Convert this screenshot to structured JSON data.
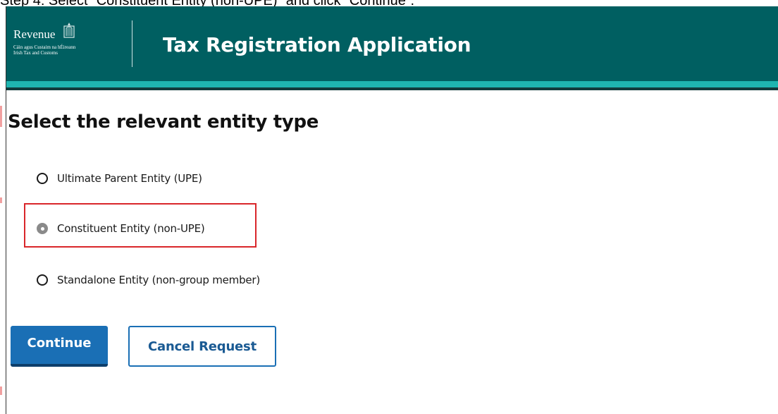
{
  "instruction": {
    "text": "Step 4: Select “Constituent Entity (non-UPE)” and click “Continue”."
  },
  "header": {
    "logo_word": "Revenue",
    "logo_subtitle_line1": "Cáin agus Custaim na hÉireann",
    "logo_subtitle_line2": "Irish Tax and Customs",
    "app_title": "Tax Registration Application"
  },
  "main": {
    "heading": "Select the relevant entity type",
    "options": [
      {
        "label": "Ultimate Parent Entity (UPE)",
        "selected": false
      },
      {
        "label": "Constituent Entity (non-UPE)",
        "selected": true
      },
      {
        "label": "Standalone Entity (non-group member)",
        "selected": false
      }
    ],
    "continue_label": "Continue",
    "cancel_label": "Cancel Request"
  },
  "colors": {
    "header_bg": "#005f61",
    "header_stripe": "#1fb5b0",
    "primary_button": "#1a6fb5",
    "highlight": "#d9262a"
  }
}
